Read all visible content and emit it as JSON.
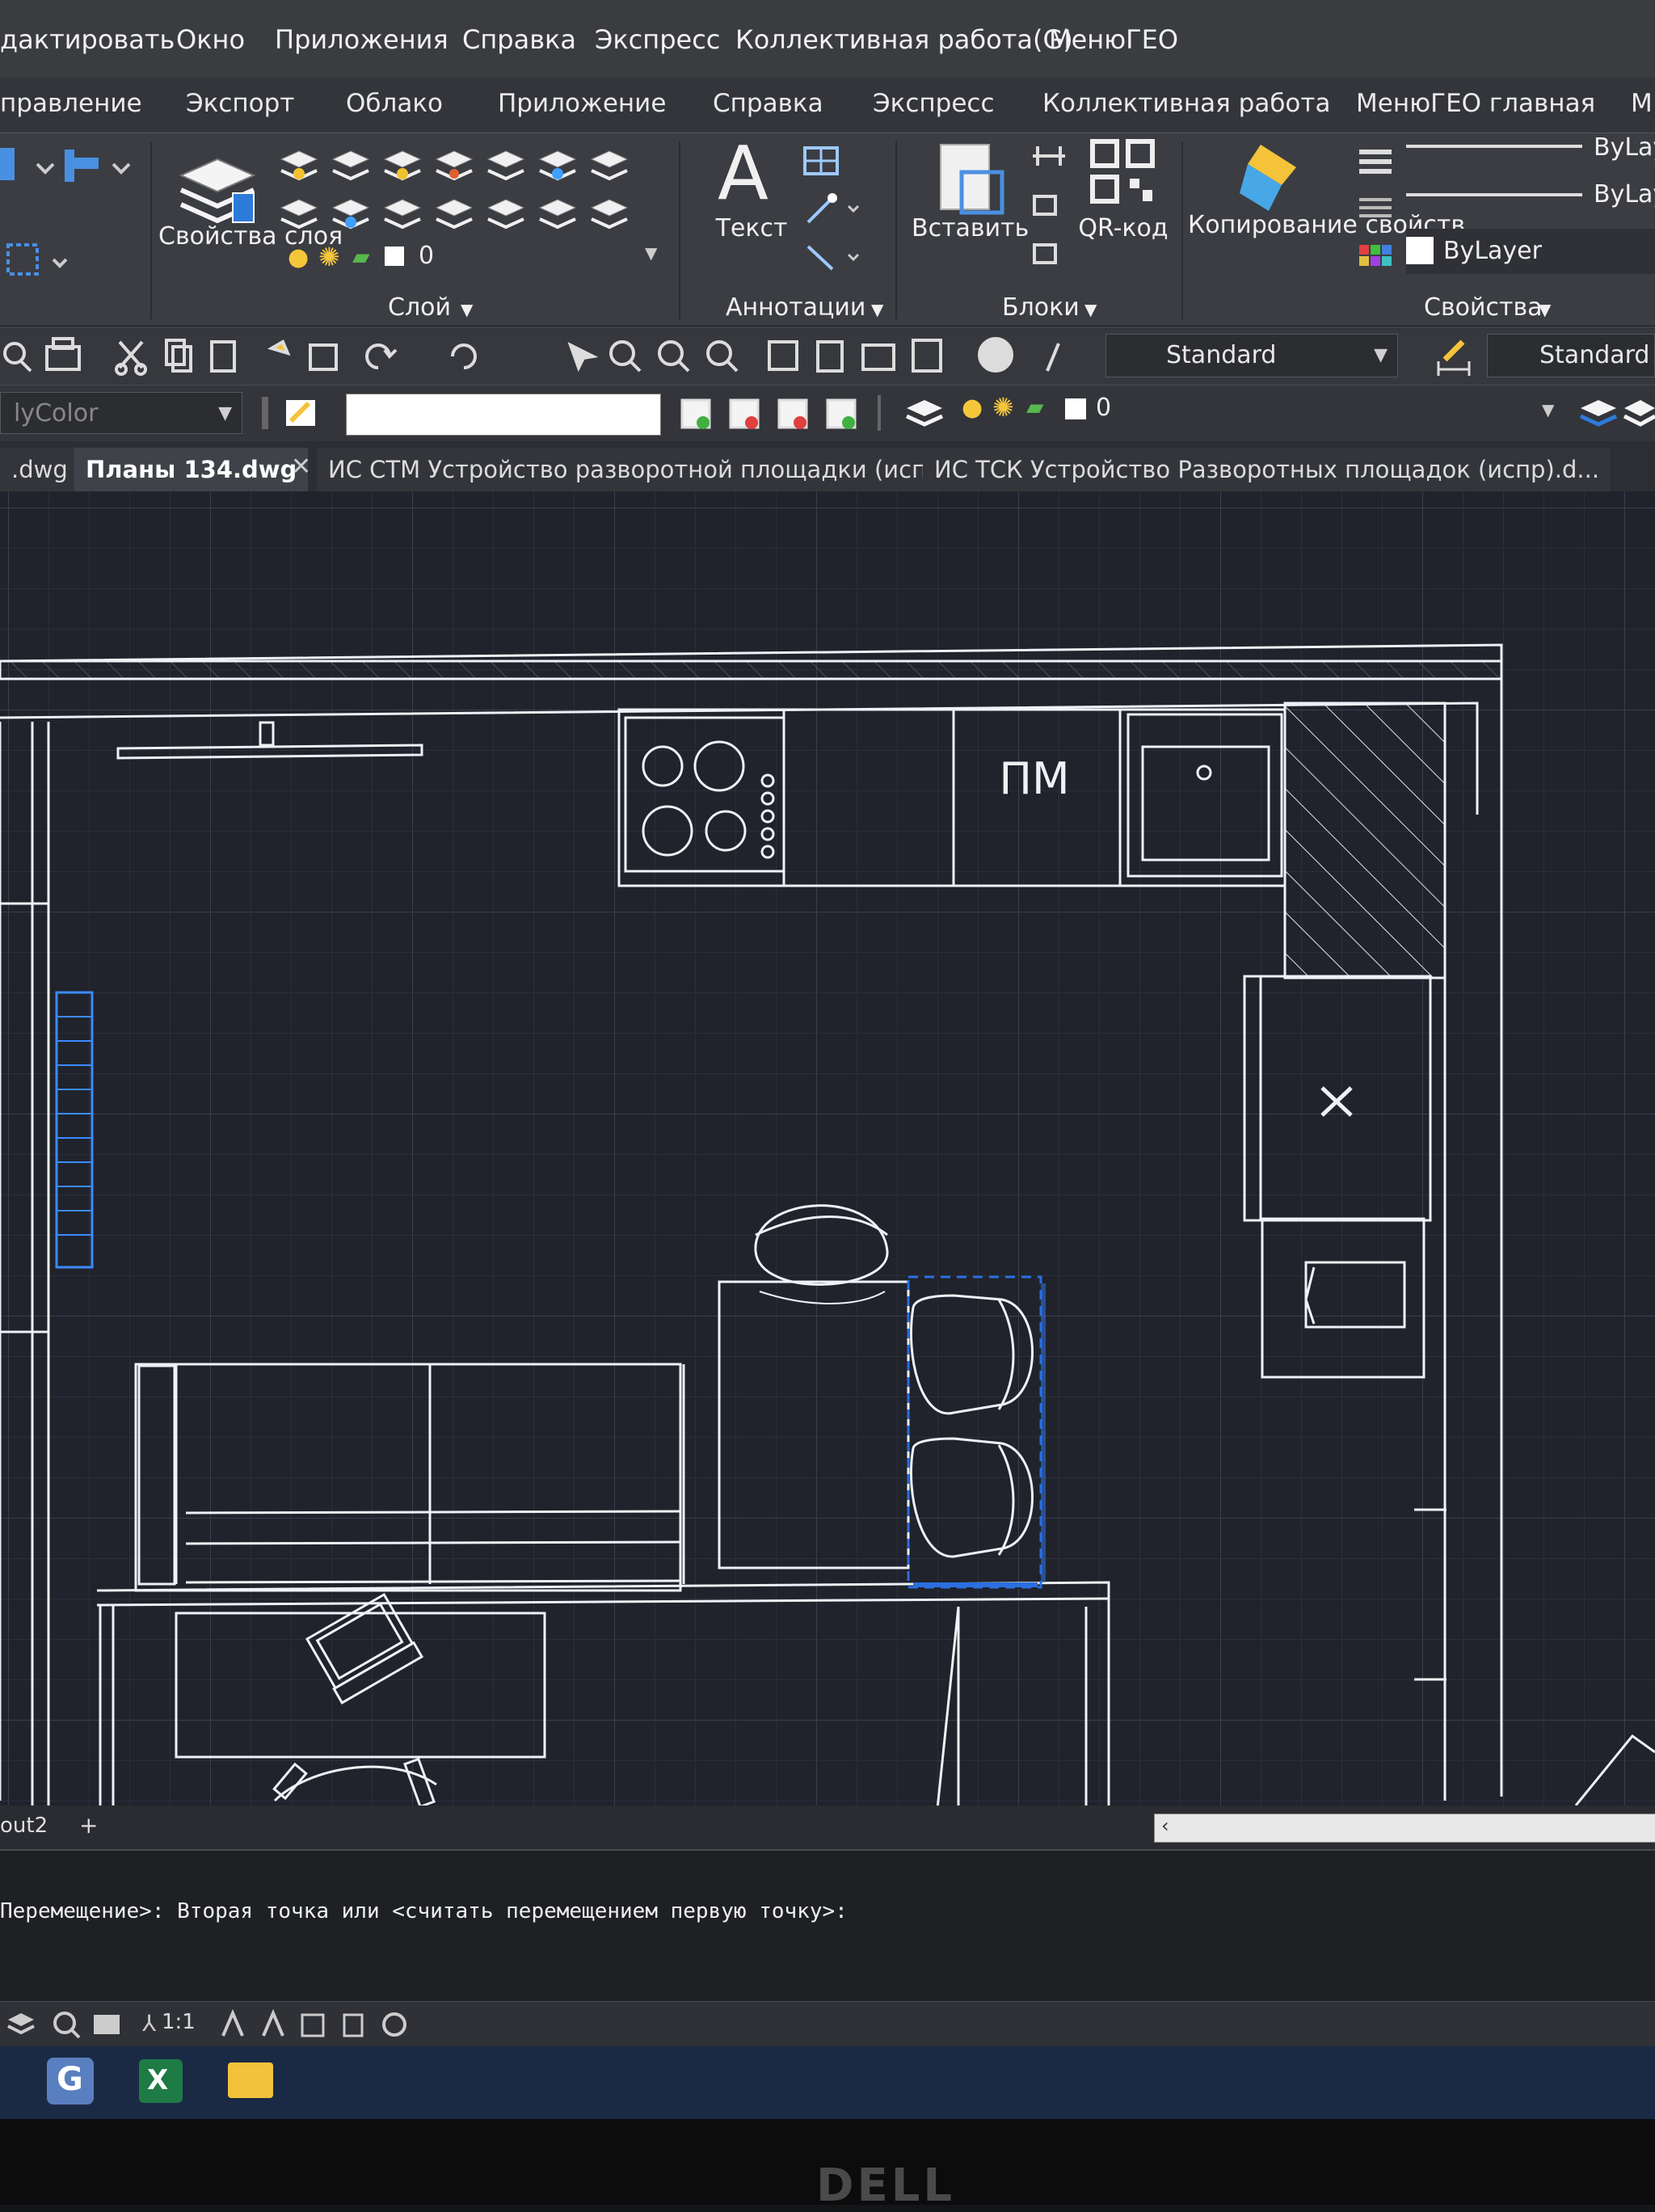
{
  "menu": {
    "items": [
      "дактировать",
      "Окно",
      "Приложения",
      "Справка",
      "Экспресс",
      "Коллективная работа(G)",
      "МенюГЕО"
    ]
  },
  "ribbon_tabs": {
    "items": [
      "правление",
      "Экспорт",
      "Облако",
      "Приложение",
      "Справка",
      "Экспресс",
      "Коллективная работа",
      "МенюГЕО главная",
      "М"
    ]
  },
  "ribbon": {
    "layer_props_label": "Свойства слоя",
    "layer_combo_value": "0",
    "layer_panel_title": "Слой",
    "text_label": "Текст",
    "annotations_title": "Аннотации",
    "insert_label": "Вставить",
    "qr_label": "QR-код",
    "blocks_title": "Блоки",
    "copy_props_label": "Копирование свойств",
    "bylayer_1": "ByLay",
    "bylayer_2": "ByLaye",
    "bylayer_3": "ByLayer",
    "properties_title": "Свойства"
  },
  "quick_access": {
    "text_style": "Standard",
    "dim_style": "Standard"
  },
  "prop_row": {
    "color_combo": "lyColor",
    "layer_value": "0"
  },
  "doc_tabs": {
    "items": [
      ".dwg",
      "Планы 134.dwg",
      "ИС СТМ Устройство разворотной площадки (испр)...",
      "ИС ТСК Устройство Разворотных площадок (испр).d..."
    ]
  },
  "drawing": {
    "fridge_label": "ПМ"
  },
  "layout_tabs": {
    "current": "out2",
    "add": "+"
  },
  "command_line": {
    "text": "Перемещение>: Вторая точка или <считать перемещением первую точку>:"
  },
  "status": {
    "scale": "1:1"
  },
  "bezel": {
    "brand": "DELL"
  },
  "colors": {
    "accent_blue": "#2b6fe0",
    "canvas": "#20232c",
    "ribbon": "#3b3d42"
  }
}
